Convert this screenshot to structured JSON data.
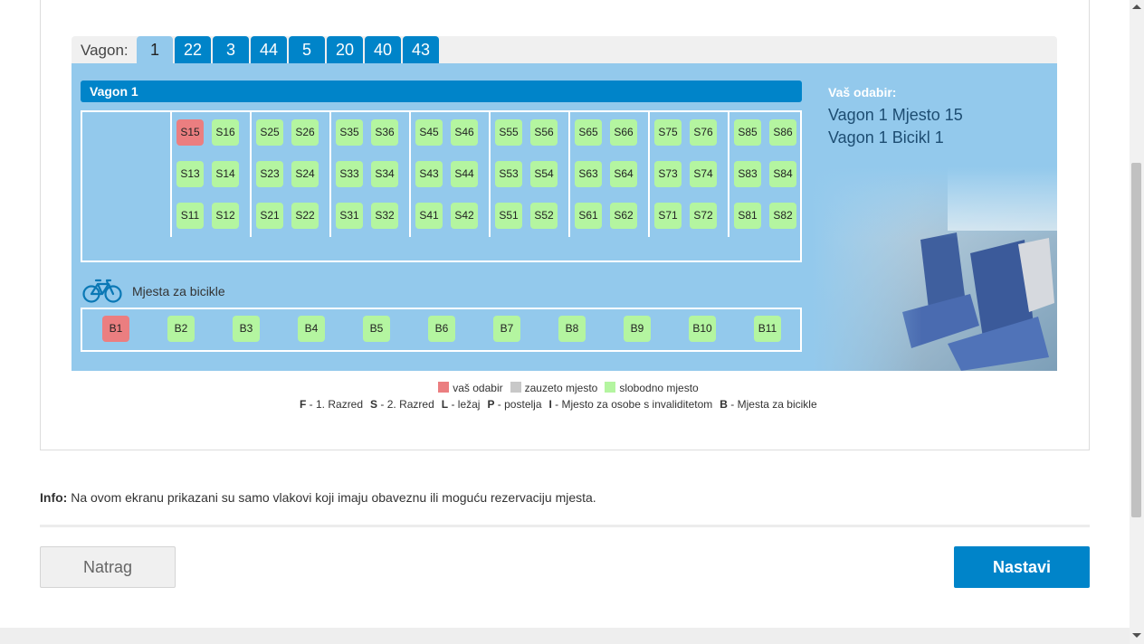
{
  "tabs": {
    "label": "Vagon:",
    "items": [
      "1",
      "22",
      "3",
      "44",
      "5",
      "20",
      "40",
      "43"
    ],
    "active": "1"
  },
  "wagon": {
    "title": "Vagon 1",
    "seats": [
      [
        "S15",
        "S16",
        "S25",
        "S26",
        "S35",
        "S36",
        "S45",
        "S46",
        "S55",
        "S56",
        "S65",
        "S66",
        "S75",
        "S76",
        "S85",
        "S86"
      ],
      [
        "S13",
        "S14",
        "S23",
        "S24",
        "S33",
        "S34",
        "S43",
        "S44",
        "S53",
        "S54",
        "S63",
        "S64",
        "S73",
        "S74",
        "S83",
        "S84"
      ],
      [
        "S11",
        "S12",
        "S21",
        "S22",
        "S31",
        "S32",
        "S41",
        "S42",
        "S51",
        "S52",
        "S61",
        "S62",
        "S71",
        "S72",
        "S81",
        "S82"
      ]
    ],
    "selected_seats": [
      "S15"
    ]
  },
  "bikes": {
    "label": "Mjesta za bicikle",
    "items": [
      "B1",
      "B2",
      "B3",
      "B4",
      "B5",
      "B6",
      "B7",
      "B8",
      "B9",
      "B10",
      "B11"
    ],
    "selected": [
      "B1"
    ]
  },
  "choice": {
    "title": "Vaš odabir:",
    "lines": [
      "Vagon 1 Mjesto 15",
      "Vagon 1 Bicikl 1"
    ]
  },
  "legend": {
    "items": [
      {
        "label": "vaš odabir",
        "color": "#eb7e80"
      },
      {
        "label": "zauzeto mjesto",
        "color": "#c8c8c8"
      },
      {
        "label": "slobodno mjesto",
        "color": "#b4f5a0"
      }
    ],
    "codes": [
      {
        "code": "F",
        "text": " - 1. Razred"
      },
      {
        "code": "S",
        "text": " - 2. Razred"
      },
      {
        "code": "L",
        "text": " - ležaj"
      },
      {
        "code": "P",
        "text": " - postelja"
      },
      {
        "code": "I",
        "text": " - Mjesto za osobe s invaliditetom"
      },
      {
        "code": "B",
        "text": " - Mjesta za bicikle"
      }
    ]
  },
  "info": {
    "label": "Info:",
    "text": " Na ovom ekranu prikazani su samo vlakovi koji imaju obaveznu ili moguću rezervaciju mjesta."
  },
  "buttons": {
    "back": "Natrag",
    "next": "Nastavi"
  },
  "colors": {
    "accent": "#0084c9",
    "panel": "#93c9ec",
    "free": "#b4f5a0",
    "selected": "#eb7e80"
  }
}
